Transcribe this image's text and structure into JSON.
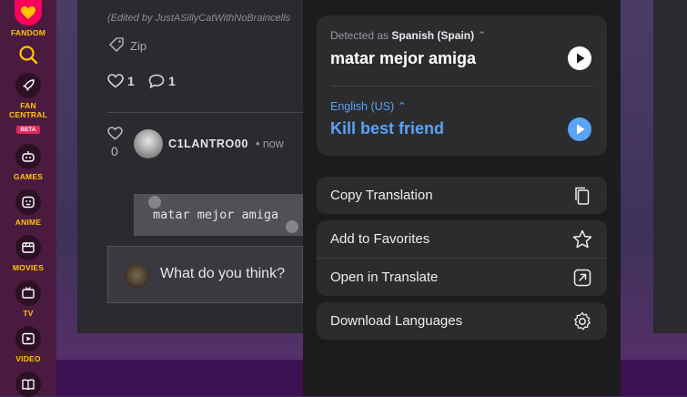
{
  "rail": {
    "items": [
      {
        "label": "FANDOM",
        "icon": "fandom-heart-icon"
      },
      {
        "label": "",
        "icon": "search-icon"
      },
      {
        "label": "FAN CENTRAL",
        "icon": "rocket-icon",
        "badge": "BETA"
      },
      {
        "label": "GAMES",
        "icon": "gamepad-icon"
      },
      {
        "label": "ANIME",
        "icon": "anime-face-icon"
      },
      {
        "label": "MOVIES",
        "icon": "movie-clapper-icon"
      },
      {
        "label": "TV",
        "icon": "tv-icon"
      },
      {
        "label": "VIDEO",
        "icon": "video-play-icon"
      },
      {
        "label": "",
        "icon": "book-icon"
      }
    ]
  },
  "post": {
    "edited_note": "(Edited by JustASillyCatWithNoBraincells",
    "tag": "Zip",
    "likes": "1",
    "comments": "1",
    "comment": {
      "likes": "0",
      "username": "C1LANTRO00",
      "time": "• now",
      "selected_text": "matar mejor amiga"
    },
    "reply_placeholder": "What do you think?"
  },
  "translate": {
    "detected_prefix": "Detected as",
    "detected_language": "Spanish (Spain)",
    "source_text": "matar mejor amiga",
    "target_language": "English (US)",
    "target_text": "Kill best friend",
    "accent_color": "#5aa3f5",
    "menu": {
      "copy": "Copy Translation",
      "favorites": "Add to Favorites",
      "open": "Open in Translate",
      "download": "Download Languages"
    }
  }
}
